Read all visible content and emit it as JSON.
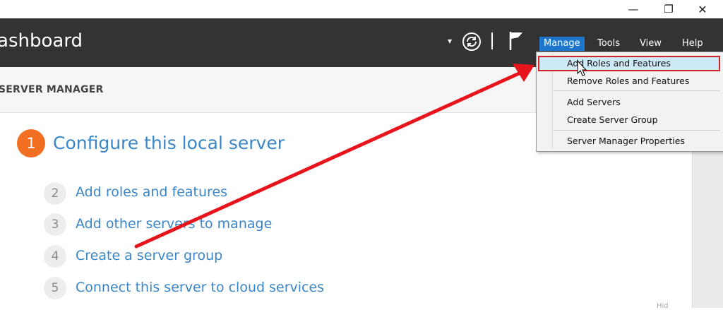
{
  "window_controls": {
    "minimize": "—",
    "maximize": "❐",
    "close": "✕"
  },
  "header": {
    "title": "Dashboard",
    "menu": {
      "manage": "Manage",
      "tools": "Tools",
      "view": "View",
      "help": "Help"
    }
  },
  "subbar": {
    "label": "SERVER MANAGER"
  },
  "quick_start": {
    "main_step": {
      "number": "1",
      "text": "Configure this local server"
    },
    "steps": [
      {
        "number": "2",
        "text": "Add roles and features"
      },
      {
        "number": "3",
        "text": "Add other servers to manage"
      },
      {
        "number": "4",
        "text": "Create a server group"
      },
      {
        "number": "5",
        "text": "Connect this server to cloud services"
      }
    ]
  },
  "manage_menu": {
    "items": [
      {
        "label": "Add Roles and Features"
      },
      {
        "label": "Remove Roles and Features"
      },
      {
        "label": "Add Servers"
      },
      {
        "label": "Create Server Group"
      },
      {
        "label": "Server Manager Properties"
      }
    ]
  },
  "colors": {
    "header_bg": "#333333",
    "menu_active": "#1d76cc",
    "link": "#3a86c8",
    "step_accent": "#f26f21",
    "highlight_border": "#d3232a",
    "arrow": "#e8141c"
  },
  "corner_text": "Hid"
}
